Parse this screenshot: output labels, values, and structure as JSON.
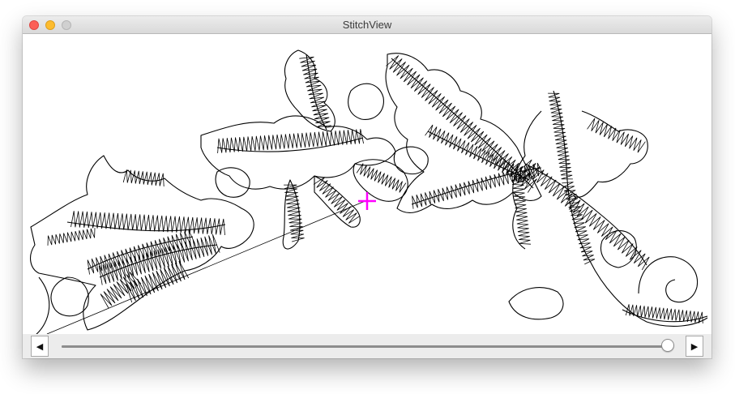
{
  "window": {
    "title": "StitchView"
  },
  "toolbar": {
    "prev_icon": "◀",
    "next_icon": "▶"
  },
  "stitch_slider": {
    "position_fraction": 0.995
  },
  "colors": {
    "stitch": "#000000",
    "needle_cursor": "#ff00ff",
    "close": "#fc5f57",
    "minimize": "#fdbc2e",
    "zoom": "#d0d0d0"
  }
}
